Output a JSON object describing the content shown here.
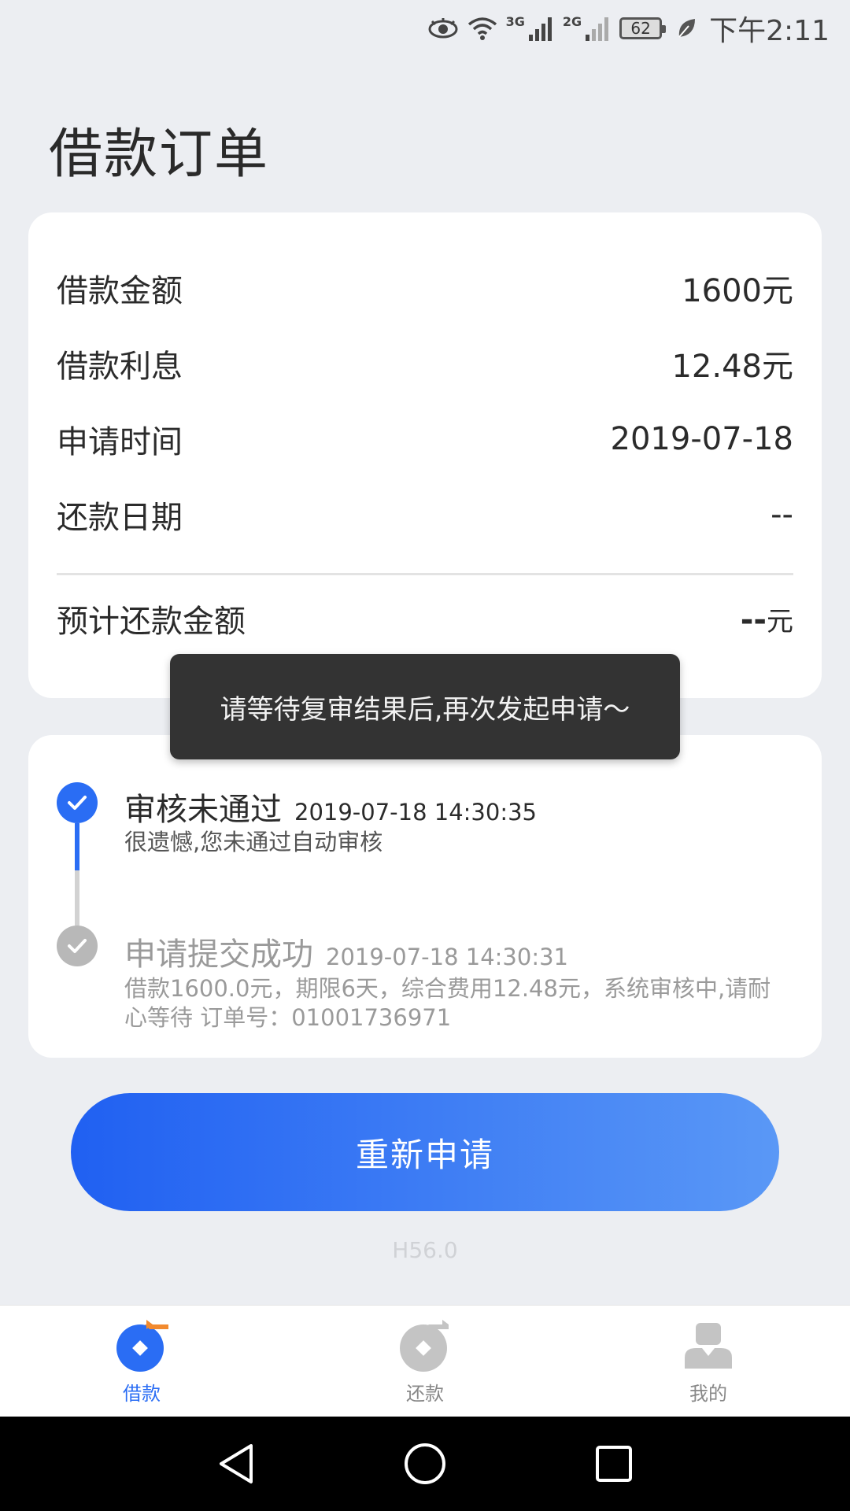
{
  "status_bar": {
    "net1": "3G",
    "net2": "2G",
    "battery": "62",
    "time": "下午2:11",
    "icons": [
      "eye-icon",
      "wifi-icon",
      "signal-icon",
      "signal-icon",
      "battery-icon",
      "leaf-icon"
    ]
  },
  "page": {
    "title": "借款订单"
  },
  "order": {
    "rows": [
      {
        "label": "借款金额",
        "value": "1600元"
      },
      {
        "label": "借款利息",
        "value": "12.48元"
      },
      {
        "label": "申请时间",
        "value": "2019-07-18"
      },
      {
        "label": "还款日期",
        "value": "--"
      }
    ],
    "estimate_label": "预计还款金额",
    "estimate_value": "--",
    "estimate_unit": "元"
  },
  "toast": {
    "text": "请等待复审结果后,再次发起申请～"
  },
  "timeline": [
    {
      "title": "审核未通过",
      "time": "2019-07-18 14:30:35",
      "desc": "很遗憾,您未通过自动审核"
    },
    {
      "title": "申请提交成功",
      "time": "2019-07-18 14:30:31",
      "desc": "借款1600.0元，期限6天，综合费用12.48元，系统审核中,请耐心等待 订单号：01001736971"
    }
  ],
  "actions": {
    "reapply_label": "重新申请"
  },
  "version": "H56.0",
  "tabs": [
    {
      "label": "借款",
      "icon": "borrow-icon",
      "active": true
    },
    {
      "label": "还款",
      "icon": "repay-icon",
      "active": false
    },
    {
      "label": "我的",
      "icon": "profile-icon",
      "active": false
    }
  ],
  "colors": {
    "accent": "#2a6df4",
    "background": "#eceef2",
    "toast": "#333333",
    "inactive": "#b8b8b8"
  }
}
